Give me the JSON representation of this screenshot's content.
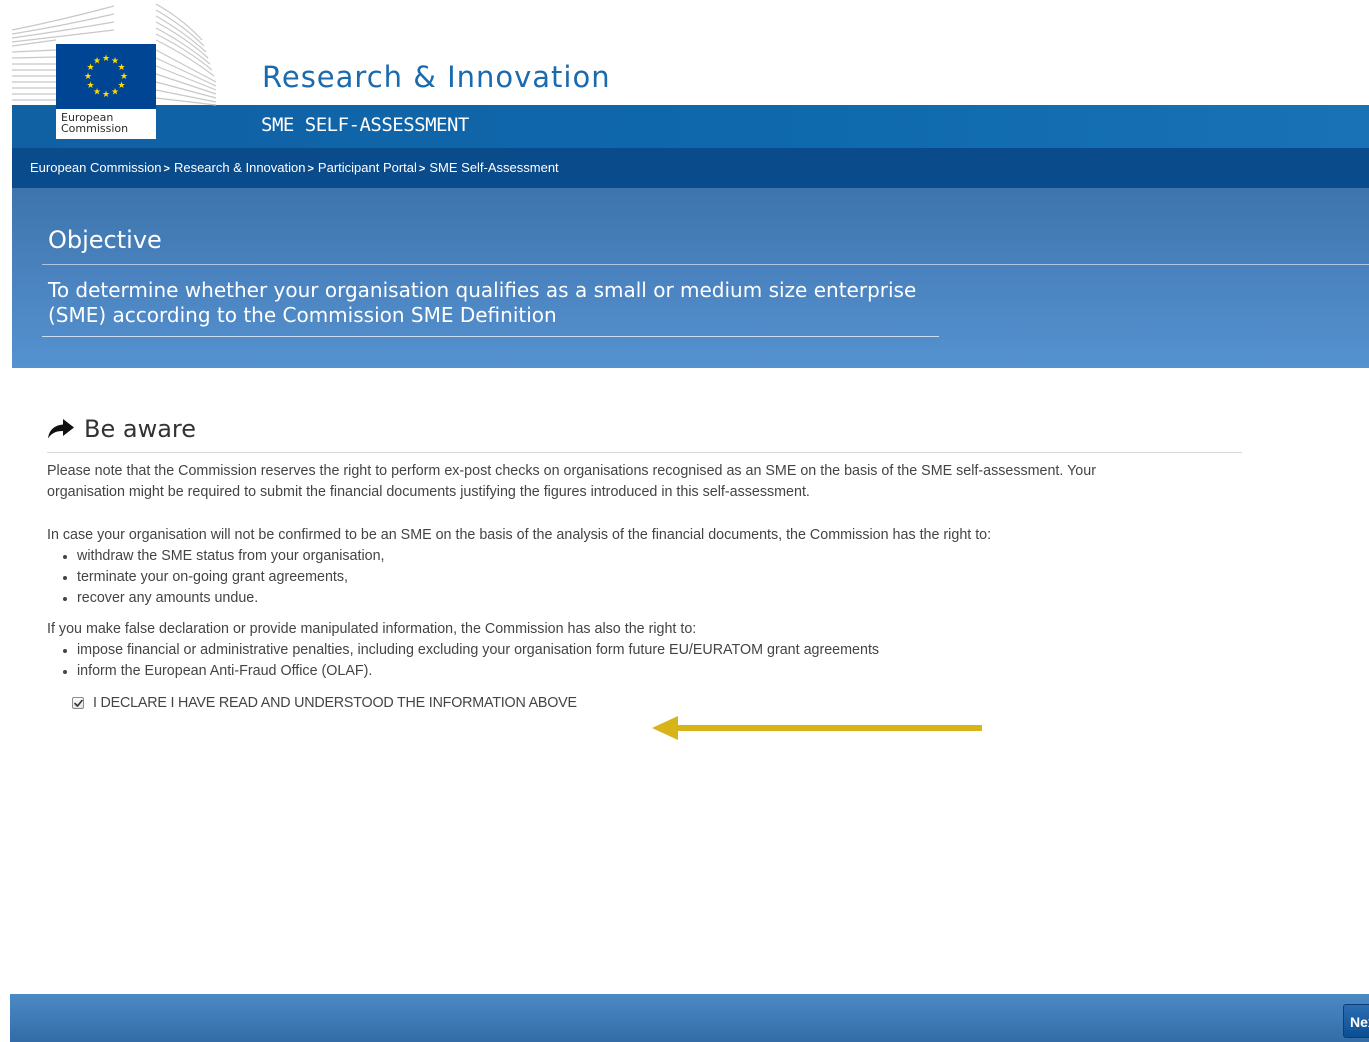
{
  "header": {
    "org_line1": "European",
    "org_line2": "Commission",
    "site_title": "Research & Innovation",
    "site_subtitle": "SME SELF-ASSESSMENT"
  },
  "breadcrumb": [
    {
      "label": "European Commission"
    },
    {
      "label": "Research & Innovation"
    },
    {
      "label": "Participant Portal"
    },
    {
      "label": "SME Self-Assessment"
    }
  ],
  "breadcrumb_separator": ">",
  "objective": {
    "title": "Objective",
    "text": "To determine whether your organisation qualifies as a small or medium size enterprise (SME) according to the Commission SME Definition"
  },
  "aware": {
    "heading": "Be aware",
    "para1": "Please note that the Commission reserves the right to perform ex-post checks on organisations recognised as an SME on the basis of the SME self-assessment. Your organisation might be required to submit the financial documents justifying the figures introduced in this self-assessment.",
    "para2": "In case your organisation will not be confirmed to be an SME on the basis of the analysis of the financial documents, the Commission has the right to:",
    "list1": [
      "withdraw the SME status from your organisation,",
      "terminate your on-going grant agreements,",
      "recover any amounts undue."
    ],
    "para3": "If you make false declaration or provide manipulated information, the Commission has also the right to:",
    "list2": [
      "impose financial or administrative penalties, including excluding your organisation form future EU/EURATOM grant agreements",
      "inform the European Anti-Fraud Office (OLAF)."
    ],
    "declaration_label": "I DECLARE I HAVE READ AND UNDERSTOOD THE INFORMATION ABOVE",
    "declaration_checked": true
  },
  "footer": {
    "next_label": "Next"
  },
  "colors": {
    "header_band": "#0f69ad",
    "breadcrumb_bg": "#0a4b8c",
    "objective_bg": "#4a83bf",
    "title_blue": "#1a6ab0",
    "flag_blue": "#004494",
    "flag_star": "#ffdd00",
    "pointer_arrow": "#d7b418"
  },
  "icons": {
    "heading_icon": "share-arrow-icon",
    "checkbox_mark": "check-icon",
    "pointer": "yellow-left-arrow-icon"
  }
}
